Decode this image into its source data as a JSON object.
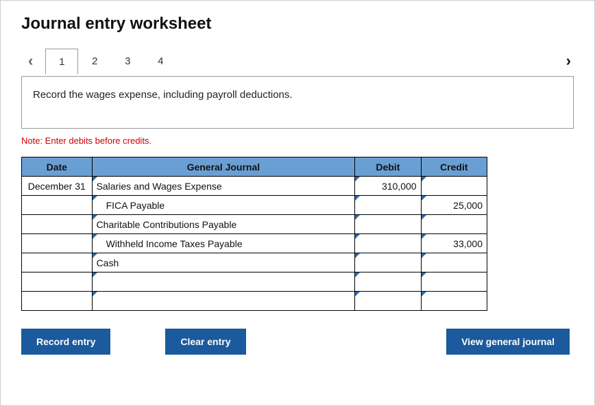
{
  "title": "Journal entry worksheet",
  "nav": {
    "prev": "‹",
    "next": "›"
  },
  "tabs": [
    {
      "label": "1",
      "active": true
    },
    {
      "label": "2",
      "active": false
    },
    {
      "label": "3",
      "active": false
    },
    {
      "label": "4",
      "active": false
    }
  ],
  "instruction": "Record the wages expense, including payroll deductions.",
  "note": "Note: Enter debits before credits.",
  "headers": {
    "date": "Date",
    "gj": "General Journal",
    "debit": "Debit",
    "credit": "Credit"
  },
  "rows": [
    {
      "date": "December 31",
      "account": "Salaries and Wages Expense",
      "debit": "310,000",
      "credit": "",
      "indent": false
    },
    {
      "date": "",
      "account": "FICA Payable",
      "debit": "",
      "credit": "25,000",
      "indent": true
    },
    {
      "date": "",
      "account": "Charitable Contributions Payable",
      "debit": "",
      "credit": "",
      "indent": false
    },
    {
      "date": "",
      "account": "Withheld Income Taxes Payable",
      "debit": "",
      "credit": "33,000",
      "indent": true
    },
    {
      "date": "",
      "account": "Cash",
      "debit": "",
      "credit": "",
      "indent": false
    },
    {
      "date": "",
      "account": "",
      "debit": "",
      "credit": "",
      "indent": false
    },
    {
      "date": "",
      "account": "",
      "debit": "",
      "credit": "",
      "indent": false
    }
  ],
  "buttons": {
    "record": "Record entry",
    "clear": "Clear entry",
    "view": "View general journal"
  }
}
